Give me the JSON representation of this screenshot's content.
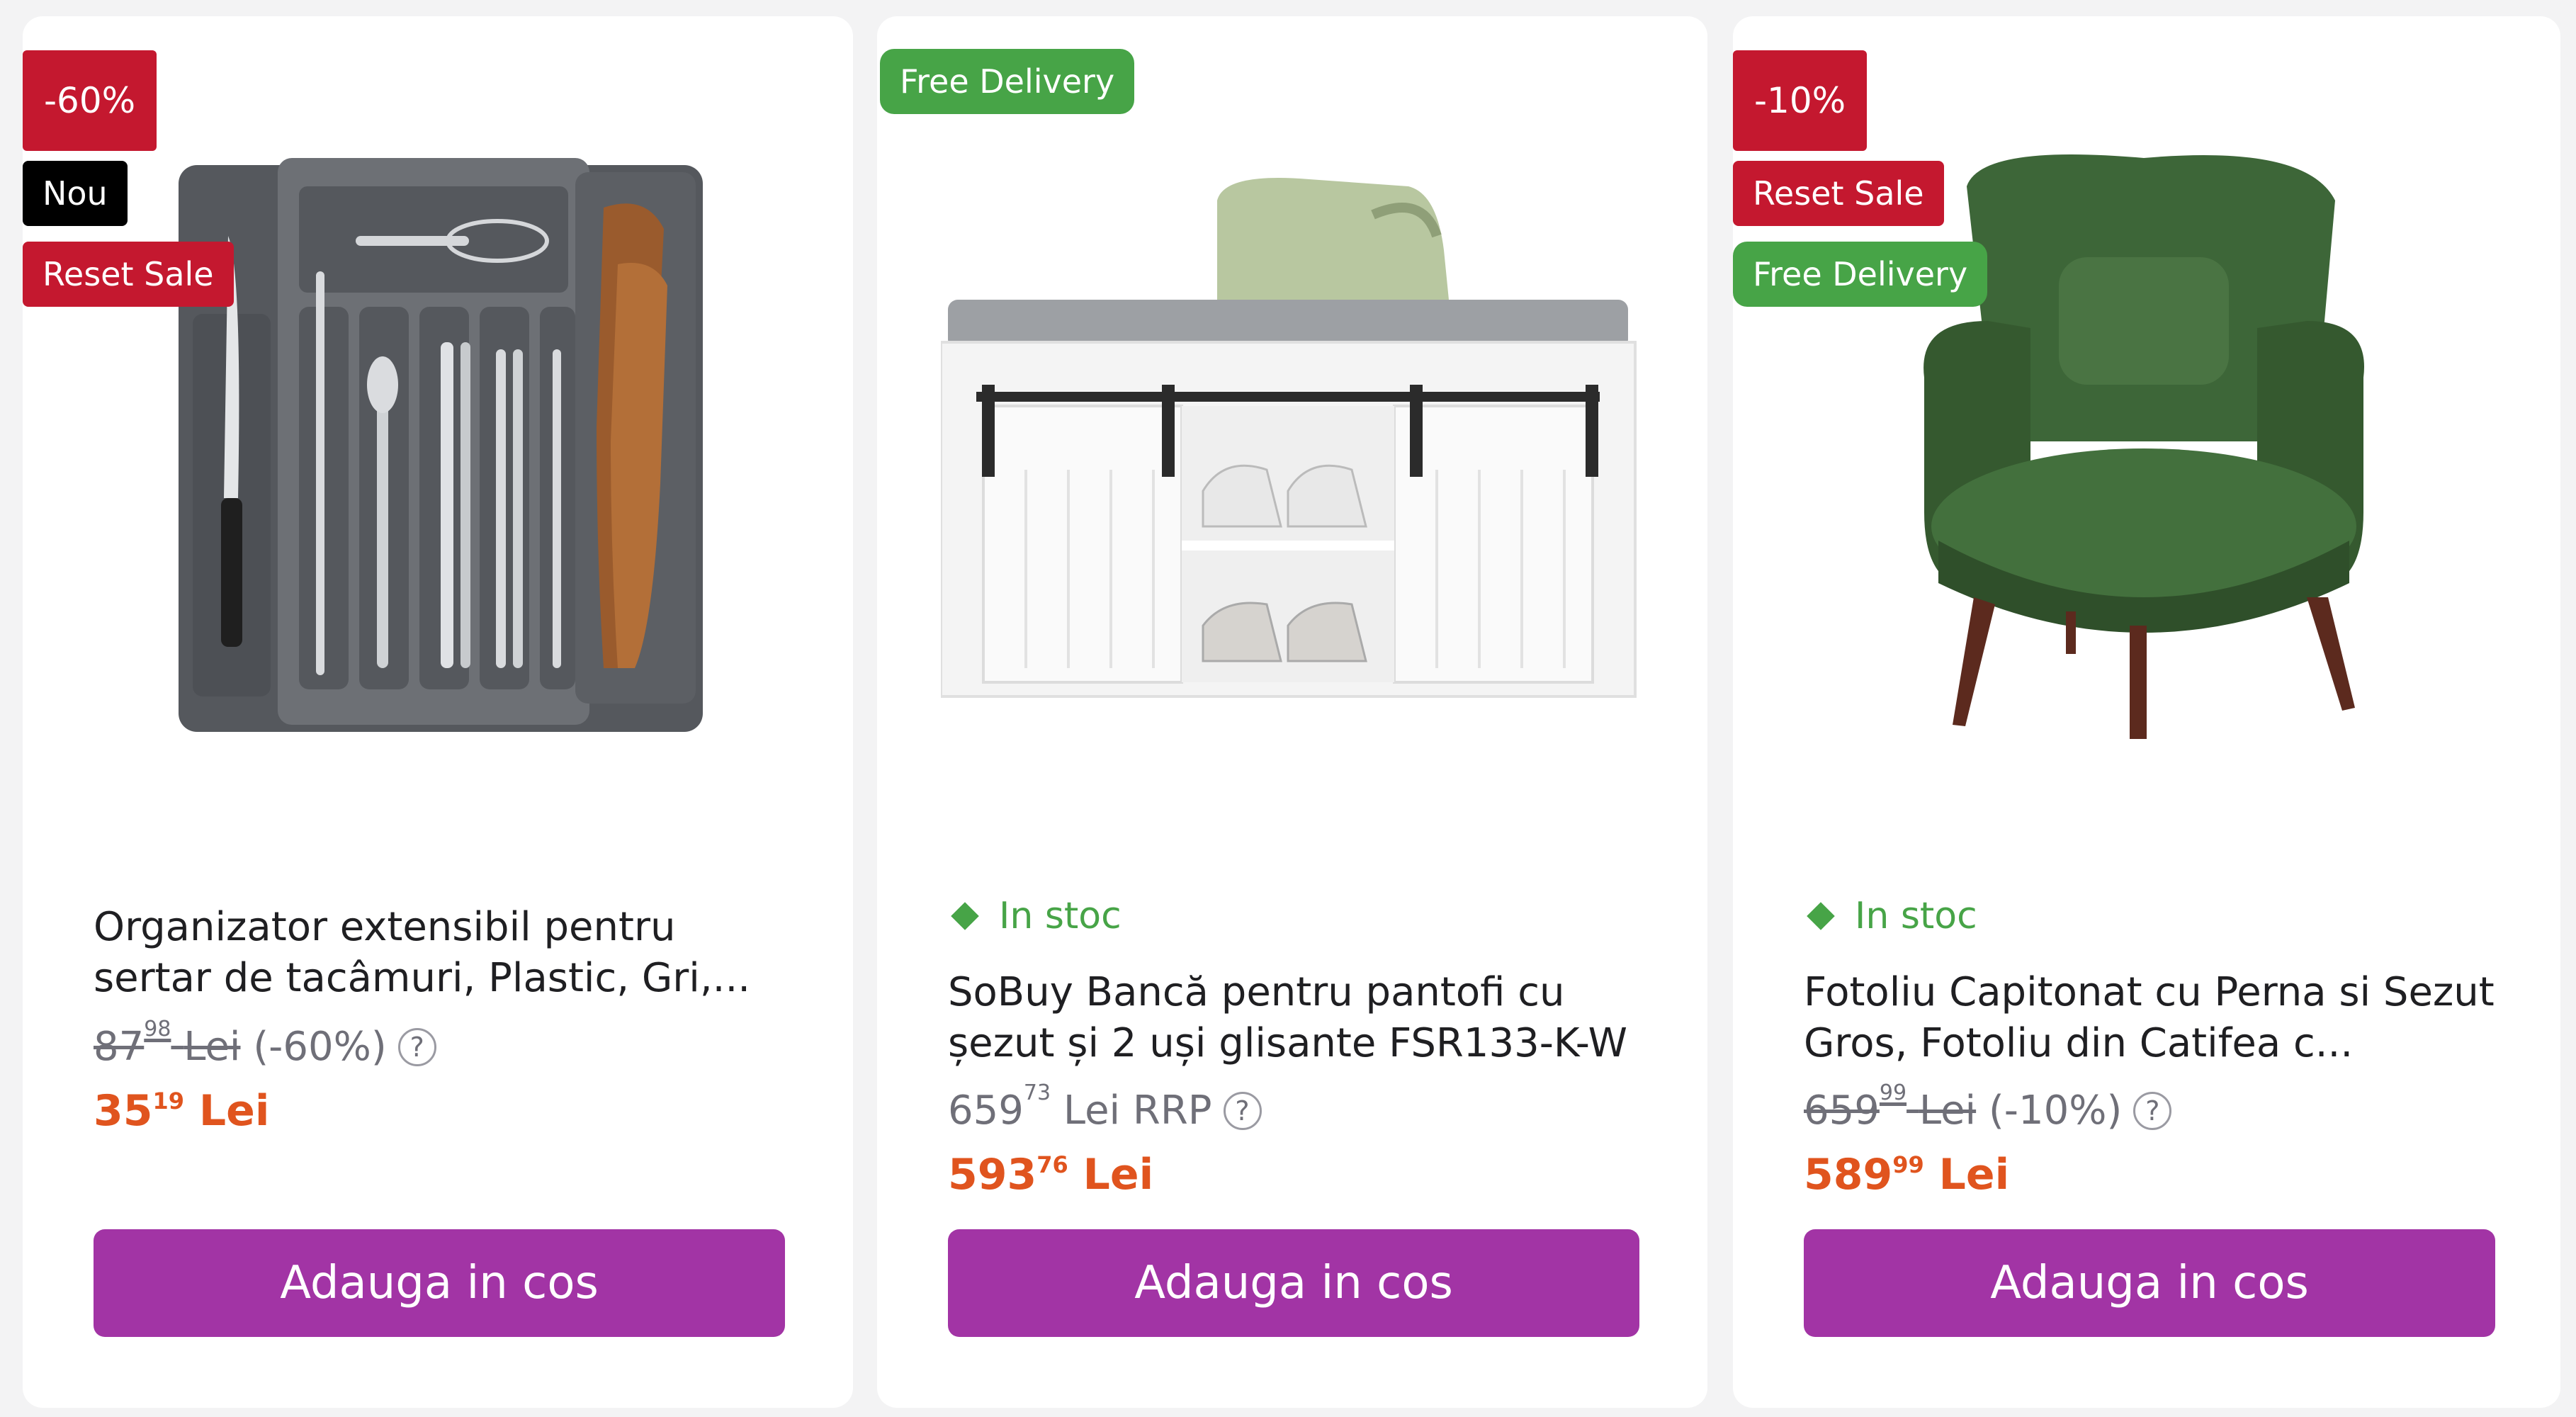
{
  "products": [
    {
      "badges": [
        "-60%",
        "Nou",
        "Reset Sale"
      ],
      "title": "Organizator extensibil pentru sertar de tacâmuri, Plastic, Gri,...",
      "old_price_int": "87",
      "old_price_dec": "98",
      "old_price_currency": "Lei",
      "discount": "(-60%)",
      "price_int": "35",
      "price_dec": "19",
      "price_currency": "Lei",
      "button": "Adauga in cos",
      "image_icon": "cutlery-organizer-image"
    },
    {
      "badges": [
        "Free Delivery"
      ],
      "stock": "In stoc",
      "title": "SoBuy Bancă pentru pantofi cu șezut și 2 uși glisante FSR133-K-W",
      "rrp_int": "659",
      "rrp_dec": "73",
      "rrp_label": "Lei RRP",
      "price_int": "593",
      "price_dec": "76",
      "price_currency": "Lei",
      "button": "Adauga in cos",
      "image_icon": "shoe-bench-image"
    },
    {
      "badges": [
        "-10%",
        "Reset Sale",
        "Free Delivery"
      ],
      "stock": "In stoc",
      "title": "Fotoliu Capitonat cu Perna si Sezut Gros, Fotoliu din Catifea c...",
      "old_price_int": "659",
      "old_price_dec": "99",
      "old_price_currency": "Lei",
      "discount": "(-10%)",
      "price_int": "589",
      "price_dec": "99",
      "price_currency": "Lei",
      "button": "Adauga in cos",
      "image_icon": "armchair-image"
    }
  ],
  "help_mark": "?",
  "colors": {
    "badge_red": "#c4182f",
    "badge_green": "#47a447",
    "badge_black": "#000000",
    "price_orange": "#e0541e",
    "button_purple": "#a234a5",
    "stock_green": "#47a447"
  }
}
